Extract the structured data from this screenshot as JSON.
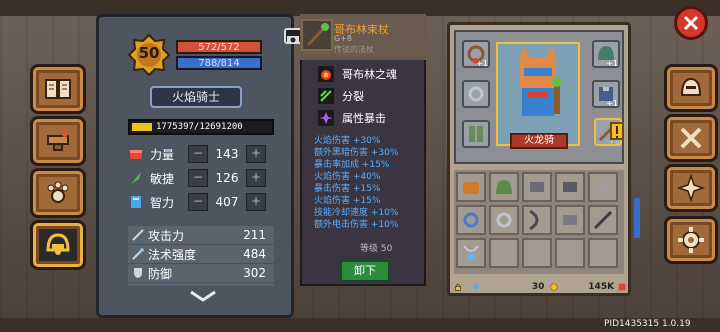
{
  "player": {
    "level": "50",
    "hp": "572/572",
    "mp": "788/814",
    "class_name": "火焰骑士",
    "xp_text": "1775397/12691200",
    "xp_progress": 0.14
  },
  "attributes": [
    {
      "name": "力量",
      "value": "143",
      "icon": "fist-icon"
    },
    {
      "name": "敏捷",
      "value": "126",
      "icon": "feather-icon"
    },
    {
      "name": "智力",
      "value": "407",
      "icon": "book-icon"
    }
  ],
  "combat": [
    {
      "name": "攻击力",
      "value": "211",
      "icon": "sword-icon"
    },
    {
      "name": "法术强度",
      "value": "484",
      "icon": "wand-icon"
    },
    {
      "name": "防御",
      "value": "302",
      "icon": "shield-icon"
    }
  ],
  "tooltip": {
    "title": "哥布林束杖",
    "grade": "G+8",
    "subtitle": "传说的法杖",
    "skills": [
      {
        "name": "哥布林之魂",
        "icon": "fire-orb-icon"
      },
      {
        "name": "分裂",
        "icon": "split-arrow-icon"
      },
      {
        "name": "属性暴击",
        "icon": "crit-burst-icon"
      }
    ],
    "stats": [
      "火焰伤害 +30%",
      "额外黑暗伤害 +30%",
      "暴击率加成 +15%",
      "火焰伤害 +40%",
      "暴击伤害 +15%",
      "火焰伤害 +15%",
      "技能冷却速度 +10%",
      "额外电击伤害 +10%"
    ],
    "level_label": "等级 50",
    "unequip_label": "卸下"
  },
  "equipment": {
    "character_name": "火龙骑",
    "weapon_plus": "+8",
    "slot_plus_labels": [
      "+1",
      "+1",
      "+1"
    ]
  },
  "bag_footer": {
    "gems": "30",
    "coins": "145K"
  },
  "build_id": "PID1435315 1.0.19",
  "colors": {
    "hp": "#d0523a",
    "mp": "#3a6ec8",
    "stat_blue": "#5ab0ff",
    "title_orange": "#f0a030",
    "unequip_green": "#2e8a3e"
  }
}
